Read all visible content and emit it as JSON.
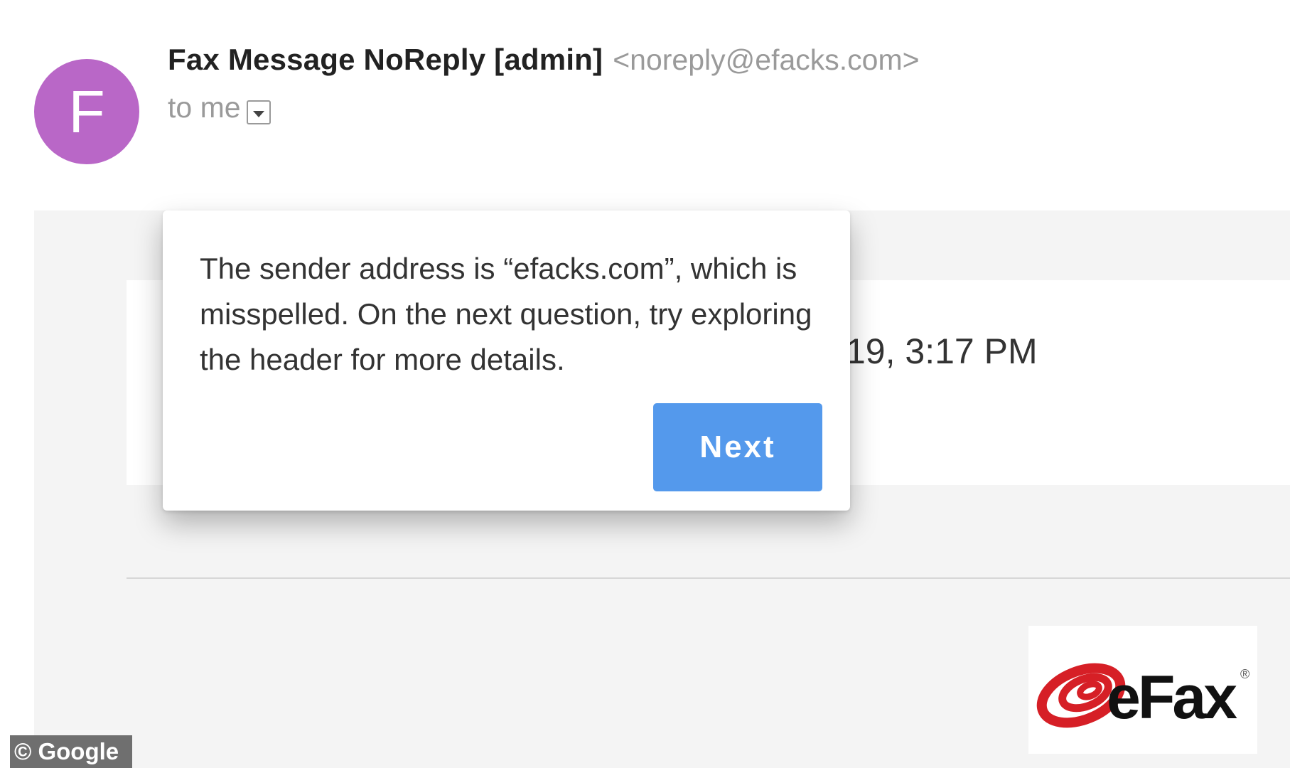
{
  "email": {
    "avatar_letter": "F",
    "avatar_color": "#b967c7",
    "sender_name": "Fax Message NoReply [admin]",
    "sender_email": "<noreply@efacks.com>",
    "recipient": "to me",
    "recipient_dropdown_icon": "chevron-down-icon",
    "date_partial": "19, 3:17 PM"
  },
  "tooltip": {
    "message": "The sender address is “efacks.com”, which is misspelled. On the next question, try exploring the header for more details.",
    "next_label": "Next",
    "button_color": "#5499ec"
  },
  "logo": {
    "brand_text": "eFax",
    "registered_mark": "®",
    "brand_color": "#d61f26"
  },
  "credit": {
    "text": "© Google"
  }
}
